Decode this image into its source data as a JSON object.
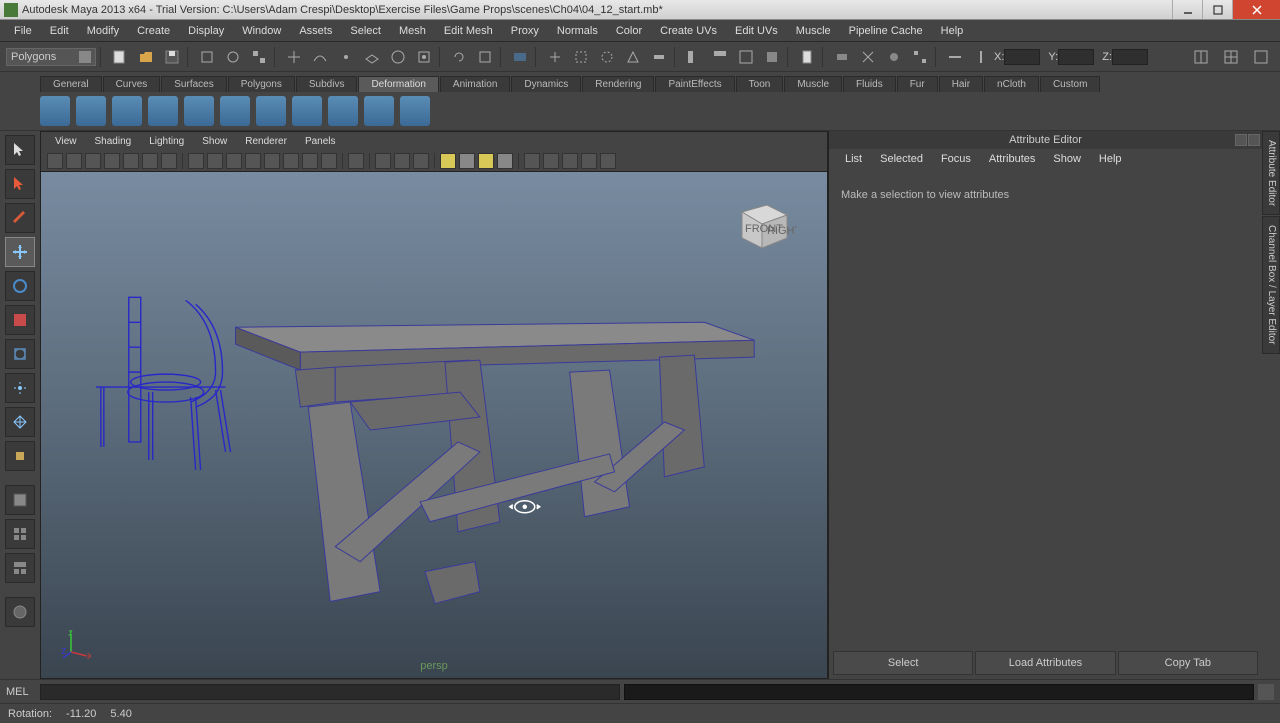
{
  "title": "Autodesk Maya 2013 x64 - Trial Version: C:\\Users\\Adam Crespi\\Desktop\\Exercise Files\\Game Props\\scenes\\Ch04\\04_12_start.mb*",
  "menus": [
    "File",
    "Edit",
    "Modify",
    "Create",
    "Display",
    "Window",
    "Assets",
    "Select",
    "Mesh",
    "Edit Mesh",
    "Proxy",
    "Normals",
    "Color",
    "Create UVs",
    "Edit UVs",
    "Muscle",
    "Pipeline Cache",
    "Help"
  ],
  "module_dropdown": "Polygons",
  "coords": {
    "x": "X:",
    "y": "Y:",
    "z": "Z:"
  },
  "shelf_tabs": [
    "General",
    "Curves",
    "Surfaces",
    "Polygons",
    "Subdivs",
    "Deformation",
    "Animation",
    "Dynamics",
    "Rendering",
    "PaintEffects",
    "Toon",
    "Muscle",
    "Fluids",
    "Fur",
    "Hair",
    "nCloth",
    "Custom"
  ],
  "active_shelf_tab": "Deformation",
  "viewport_menus": [
    "View",
    "Shading",
    "Lighting",
    "Show",
    "Renderer",
    "Panels"
  ],
  "persp_label": "persp",
  "nav_cube": {
    "front": "FRONT",
    "right": "RIGHT"
  },
  "attr_editor": {
    "title": "Attribute Editor",
    "menus": [
      "List",
      "Selected",
      "Focus",
      "Attributes",
      "Show",
      "Help"
    ],
    "message": "Make a selection to view attributes",
    "buttons": {
      "select": "Select",
      "load": "Load Attributes",
      "copy": "Copy Tab"
    }
  },
  "side_tabs": [
    "Attribute Editor",
    "Channel Box / Layer Editor"
  ],
  "cmdline_label": "MEL",
  "status": {
    "label": "Rotation:",
    "v1": "-11.20",
    "v2": "5.40"
  }
}
